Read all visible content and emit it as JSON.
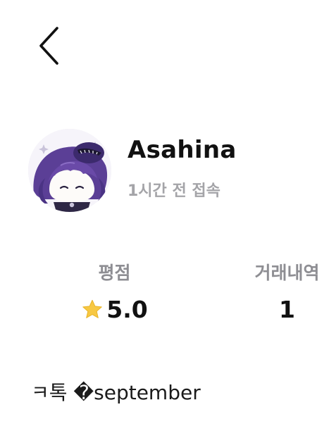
{
  "header": {
    "back_icon": "chevron-left-icon"
  },
  "profile": {
    "avatar_icon": "character-avatar",
    "name": "Asahina",
    "last_seen": "1시간 전 접속"
  },
  "stats": {
    "rating_label": "평점",
    "rating_value": "5.0",
    "rating_icon": "star-icon",
    "rating_icon_color": "#F7C843",
    "trades_label": "거래내역",
    "trades_value": "1"
  },
  "bio": {
    "text": "ㅋ톡 �september"
  }
}
